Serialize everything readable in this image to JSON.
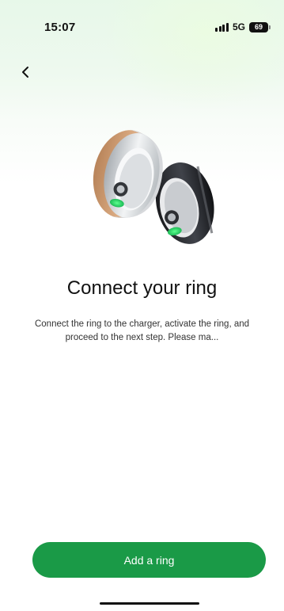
{
  "status_bar": {
    "time": "15:07",
    "network": "5G",
    "battery": "69"
  },
  "header": {
    "back_icon": "chevron-left-icon"
  },
  "main": {
    "illustration": "smart-ring-illustration",
    "title": "Connect your ring",
    "description": "Connect the ring to the charger, activate the ring, and proceed to the next step. Please ma..."
  },
  "footer": {
    "button_label": "Add a ring"
  },
  "colors": {
    "accent": "#1a9a47",
    "title_text": "#111111",
    "body_text": "#333333"
  }
}
